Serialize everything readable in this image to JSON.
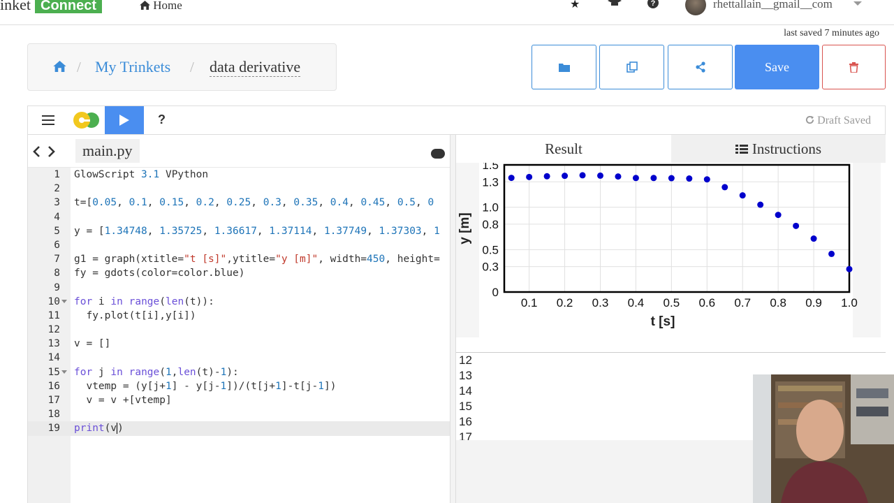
{
  "topbar": {
    "brand_prefix": "inket",
    "brand_connect": "Connect",
    "home_label": "Home",
    "username": "rhettallain__gmail__com"
  },
  "status": {
    "last_saved": "last saved 7 minutes ago"
  },
  "breadcrumb": {
    "link": "My Trinkets",
    "separator": "/",
    "current": "data derivative"
  },
  "toolbar": {
    "save_label": "Save"
  },
  "editor": {
    "draft_status": "Draft Saved",
    "help_label": "?",
    "file_tab": "main.py",
    "lines": [
      {
        "n": "1",
        "text": "GlowScript 3.1 VPython"
      },
      {
        "n": "2",
        "text": ""
      },
      {
        "n": "3",
        "text": "t=[0.05, 0.1, 0.15, 0.2, 0.25, 0.3, 0.35, 0.4, 0.45, 0.5, 0"
      },
      {
        "n": "4",
        "text": ""
      },
      {
        "n": "5",
        "text": "y = [1.34748, 1.35725, 1.36617, 1.37114, 1.37749, 1.37303, 1"
      },
      {
        "n": "6",
        "text": ""
      },
      {
        "n": "7",
        "text": "g1 = graph(xtitle=\"t [s]\",ytitle=\"y [m]\", width=450, height="
      },
      {
        "n": "8",
        "text": "fy = gdots(color=color.blue)"
      },
      {
        "n": "9",
        "text": ""
      },
      {
        "n": "10",
        "text": "for i in range(len(t)):"
      },
      {
        "n": "11",
        "text": "  fy.plot(t[i],y[i])"
      },
      {
        "n": "12",
        "text": ""
      },
      {
        "n": "13",
        "text": "v = []"
      },
      {
        "n": "14",
        "text": ""
      },
      {
        "n": "15",
        "text": "for j in range(1,len(t)-1):"
      },
      {
        "n": "16",
        "text": "  vtemp = (y[j+1] - y[j-1])/(t[j+1]-t[j-1])"
      },
      {
        "n": "17",
        "text": "  v = v +[vtemp]"
      },
      {
        "n": "18",
        "text": ""
      },
      {
        "n": "19",
        "text": "print(v)"
      }
    ]
  },
  "output": {
    "tab_result": "Result",
    "tab_instructions": "Instructions",
    "console_lines": [
      "12",
      "13",
      "14",
      "15",
      "16",
      "17"
    ]
  },
  "chart_data": {
    "type": "scatter",
    "xlabel": "t [s]",
    "ylabel": "y [m]",
    "xlim": [
      0.03,
      1.0
    ],
    "ylim": [
      0,
      1.5
    ],
    "x_ticks": [
      "0.1",
      "0.2",
      "0.3",
      "0.4",
      "0.5",
      "0.6",
      "0.7",
      "0.8",
      "0.9",
      "1.0"
    ],
    "y_ticks": [
      "0",
      "0.3",
      "0.5",
      "0.8",
      "1.0",
      "1.3",
      "1.5"
    ],
    "series": [
      {
        "color": "#0000cc",
        "x": [
          0.05,
          0.1,
          0.15,
          0.2,
          0.25,
          0.3,
          0.35,
          0.4,
          0.45,
          0.5,
          0.55,
          0.6,
          0.65,
          0.7,
          0.75,
          0.8,
          0.85,
          0.9,
          0.95,
          1.0
        ],
        "y": [
          1.347,
          1.357,
          1.366,
          1.371,
          1.377,
          1.373,
          1.363,
          1.345,
          1.345,
          1.343,
          1.339,
          1.329,
          1.237,
          1.14,
          1.03,
          0.91,
          0.78,
          0.63,
          0.45,
          0.27
        ]
      }
    ]
  }
}
